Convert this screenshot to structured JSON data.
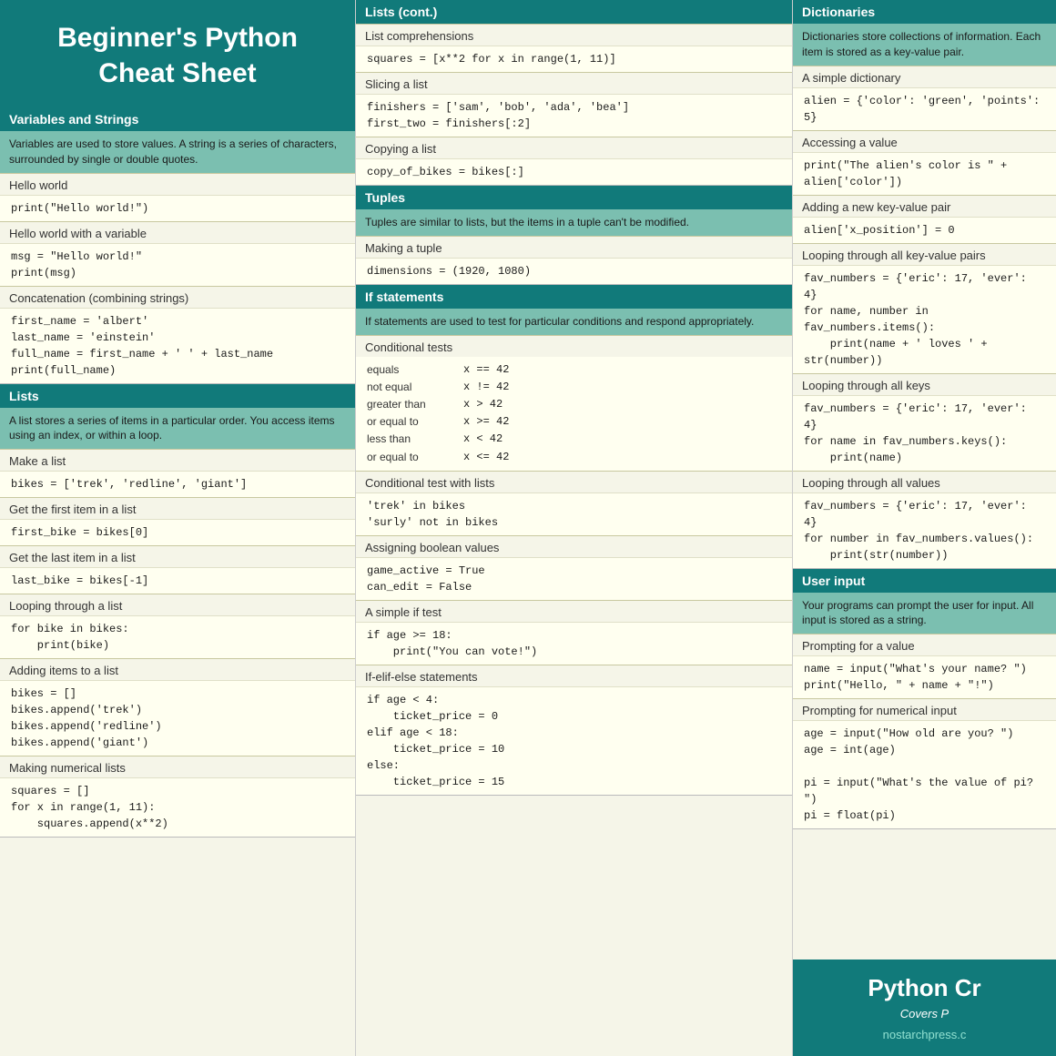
{
  "col1": {
    "title": "Beginner's Python\nCheat Sheet",
    "variables": {
      "header": "Variables and Strings",
      "desc": "Variables are used to store values. A string is a series of characters, surrounded by single or double quotes.",
      "items": [
        {
          "label": "Hello world",
          "code": "print(\"Hello world!\")"
        },
        {
          "label": "Hello world with a variable",
          "code": "msg = \"Hello world!\"\nprint(msg)"
        },
        {
          "label": "Concatenation (combining strings)",
          "code": "first_name = 'albert'\nlast_name = 'einstein'\nfull_name = first_name + ' ' + last_name\nprint(full_name)"
        }
      ]
    },
    "lists": {
      "header": "Lists",
      "desc": "A list stores a series of items in a particular order. You access items using an index, or within a loop.",
      "items": [
        {
          "label": "Make a list",
          "code": "bikes = ['trek', 'redline', 'giant']"
        },
        {
          "label": "Get the first item in a list",
          "code": "first_bike = bikes[0]"
        },
        {
          "label": "Get the last item in a list",
          "code": "last_bike = bikes[-1]"
        },
        {
          "label": "Looping through a list",
          "code": "for bike in bikes:\n    print(bike)"
        },
        {
          "label": "Adding items to a list",
          "code": "bikes = []\nbikes.append('trek')\nbikes.append('redline')\nbikes.append('giant')"
        },
        {
          "label": "Making numerical lists",
          "code": "squares = []\nfor x in range(1, 11):\n    squares.append(x**2)"
        }
      ]
    }
  },
  "col2": {
    "lists_cont": {
      "header": "Lists (cont.)",
      "items": [
        {
          "label": "List comprehensions",
          "code": "squares = [x**2 for x in range(1, 11)]"
        },
        {
          "label": "Slicing a list",
          "code": "finishers = ['sam', 'bob', 'ada', 'bea']\nfirst_two = finishers[:2]"
        },
        {
          "label": "Copying a list",
          "code": "copy_of_bikes = bikes[:]"
        }
      ]
    },
    "tuples": {
      "header": "Tuples",
      "desc": "Tuples are similar to lists, but the items in a tuple can't be modified.",
      "items": [
        {
          "label": "Making a tuple",
          "code": "dimensions = (1920, 1080)"
        }
      ]
    },
    "if_statements": {
      "header": "If statements",
      "desc": "If statements are used to test for particular conditions and respond appropriately.",
      "conditional_tests_label": "Conditional tests",
      "conditional_tests": [
        {
          "label": "equals",
          "code": "x == 42"
        },
        {
          "label": "not equal",
          "code": "x != 42"
        },
        {
          "label": "greater than",
          "code": "x > 42"
        },
        {
          "label": "or equal to",
          "code": "x >= 42"
        },
        {
          "label": "less than",
          "code": "x < 42"
        },
        {
          "label": "or equal to",
          "code": "x <= 42"
        }
      ],
      "items": [
        {
          "label": "Conditional test with lists",
          "code": "'trek' in bikes\n'surly' not in bikes"
        },
        {
          "label": "Assigning boolean values",
          "code": "game_active = True\ncan_edit = False"
        },
        {
          "label": "A simple if test",
          "code": "if age >= 18:\n    print(\"You can vote!\")"
        },
        {
          "label": "If-elif-else statements",
          "code": "if age < 4:\n    ticket_price = 0\nelif age < 18:\n    ticket_price = 10\nelse:\n    ticket_price = 15"
        }
      ]
    }
  },
  "col3": {
    "dictionaries": {
      "header": "Dictionaries",
      "desc": "Dictionaries store collections of information. Each item is stored as a key-value pair.",
      "items": [
        {
          "label": "A simple dictionary",
          "code": "alien = {'color': 'green', 'points': 5}"
        },
        {
          "label": "Accessing a value",
          "code": "print(\"The alien's color is \" + alien['color'])"
        },
        {
          "label": "Adding a new key-value pair",
          "code": "alien['x_position'] = 0"
        },
        {
          "label": "Looping through all key-value pairs",
          "code": "fav_numbers = {'eric': 17, 'ever': 4}\nfor name, number in fav_numbers.items():\n    print(name + ' loves ' + str(number))"
        },
        {
          "label": "Looping through all keys",
          "code": "fav_numbers = {'eric': 17, 'ever': 4}\nfor name in fav_numbers.keys():\n    print(name)"
        },
        {
          "label": "Looping through all values",
          "code": "fav_numbers = {'eric': 17, 'ever': 4}\nfor number in fav_numbers.values():\n    print(str(number))"
        }
      ]
    },
    "user_input": {
      "header": "User input",
      "desc": "Your programs can prompt the user for input. All input is stored as a string.",
      "items": [
        {
          "label": "Prompting for a value",
          "code": "name = input(\"What's your name? \")\nprint(\"Hello, \" + name + \"!\")"
        },
        {
          "label": "Prompting for numerical input",
          "code": "age = input(\"How old are you? \")\nage = int(age)\n\npi = input(\"What's the value of pi? \")\npi = float(pi)"
        }
      ]
    },
    "promo": {
      "title": "Python Cr",
      "subtitle": "Covers P",
      "link": "nostarchpress.c"
    }
  }
}
